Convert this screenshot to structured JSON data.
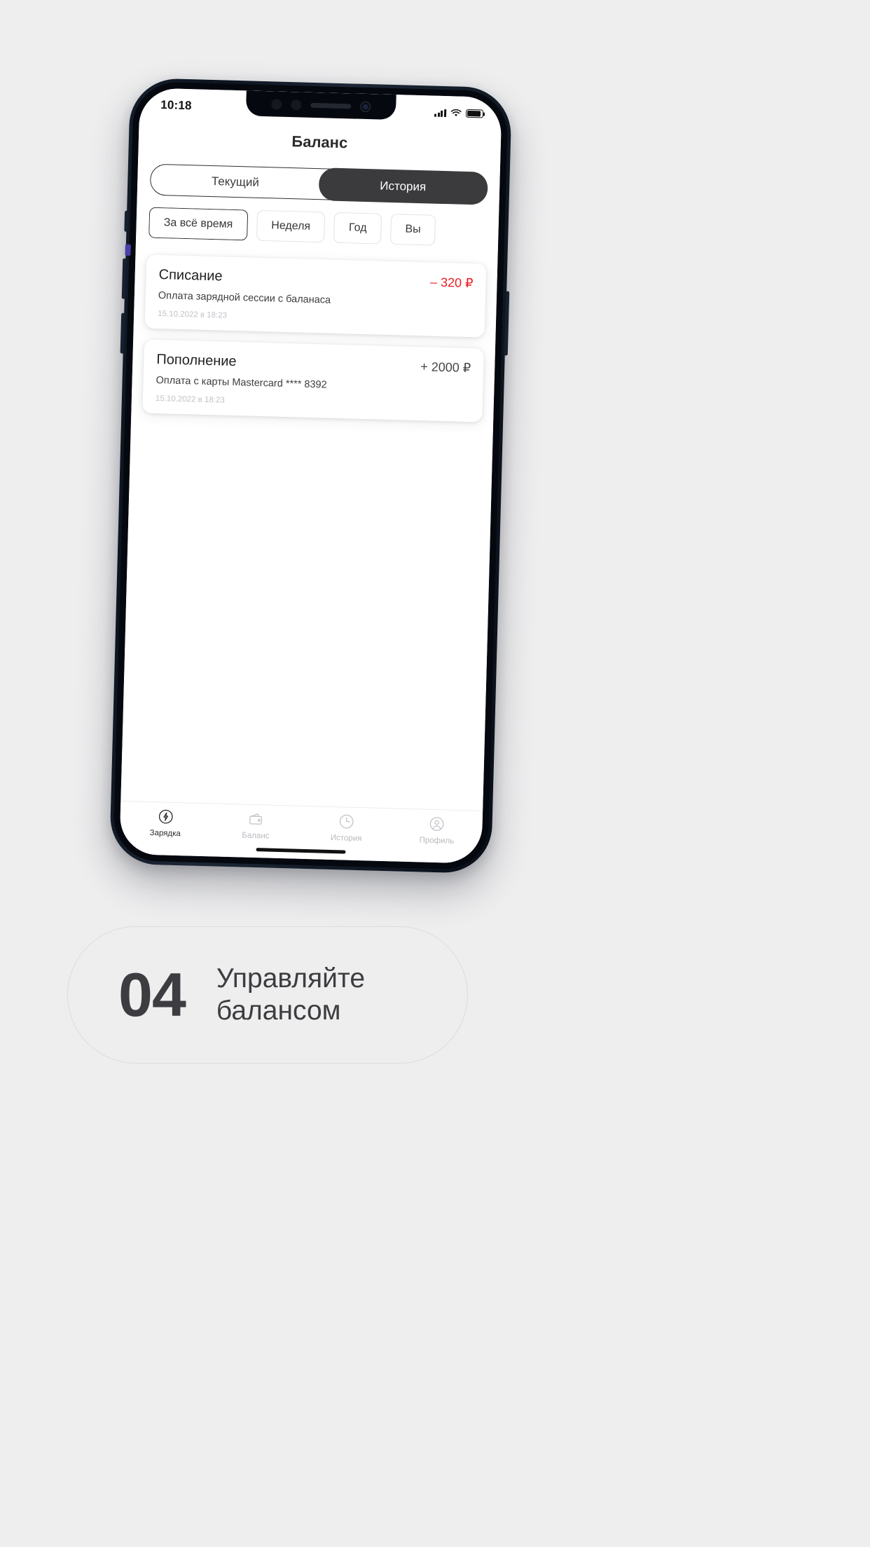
{
  "statusbar": {
    "time": "10:18",
    "signal_icon": "cellular-signal-icon",
    "wifi_icon": "wifi-icon",
    "battery_icon": "battery-icon"
  },
  "header": {
    "title": "Баланс"
  },
  "segmented": {
    "items": [
      {
        "label": "Текущий",
        "active": false
      },
      {
        "label": "История",
        "active": true
      }
    ]
  },
  "filters": {
    "chips": [
      {
        "label": "За всё время",
        "selected": true
      },
      {
        "label": "Неделя",
        "selected": false
      },
      {
        "label": "Год",
        "selected": false
      },
      {
        "label": "Вы",
        "selected": false
      }
    ]
  },
  "transactions": [
    {
      "title": "Списание",
      "amount": "– 320 ₽",
      "type": "debit",
      "description": "Оплата зарядной сессии с баланаса",
      "date": "15.10.2022 в 18:23"
    },
    {
      "title": "Пополнение",
      "amount": "+ 2000 ₽",
      "type": "credit",
      "description": "Оплата с карты Mastercard **** 8392",
      "date": "15.10.2022 в 18:23"
    }
  ],
  "tabbar": {
    "items": [
      {
        "label": "Зарядка",
        "icon": "charging-bolt-icon",
        "active": true
      },
      {
        "label": "Баланс",
        "icon": "wallet-icon",
        "active": false
      },
      {
        "label": "История",
        "icon": "clock-icon",
        "active": false
      },
      {
        "label": "Профиль",
        "icon": "user-icon",
        "active": false
      }
    ]
  },
  "caption": {
    "number": "04",
    "text": "Управляйте балансом"
  },
  "colors": {
    "background": "#eeeeef",
    "accent_dark": "#3b3b3d",
    "debit_red": "#ec1c24",
    "muted_text": "#c2c2c8"
  }
}
